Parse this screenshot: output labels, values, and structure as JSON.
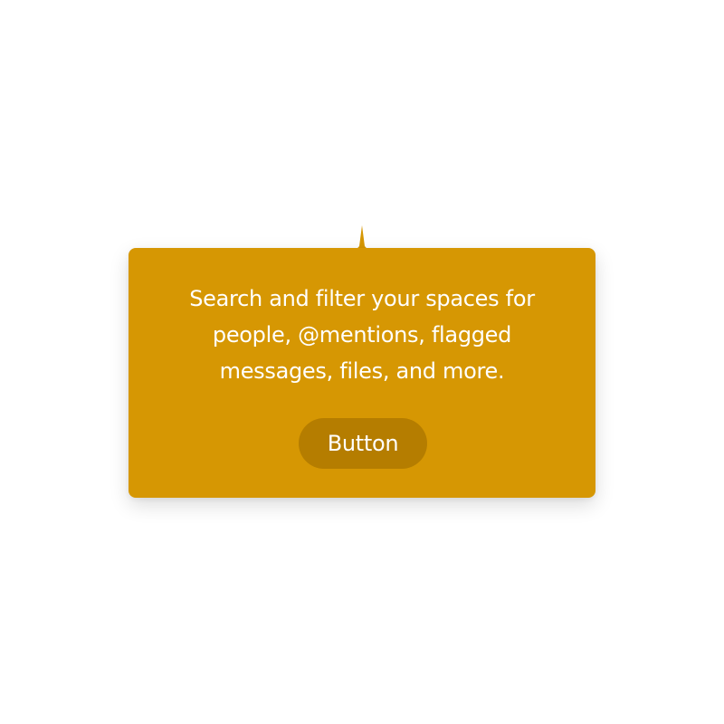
{
  "popover": {
    "message": "Search and filter your spaces for people, @mentions, flagged messages, files, and more.",
    "button_label": "Button"
  },
  "colors": {
    "popover_background": "#D69703",
    "button_background": "#B57D00",
    "text": "#FFFFFF"
  }
}
